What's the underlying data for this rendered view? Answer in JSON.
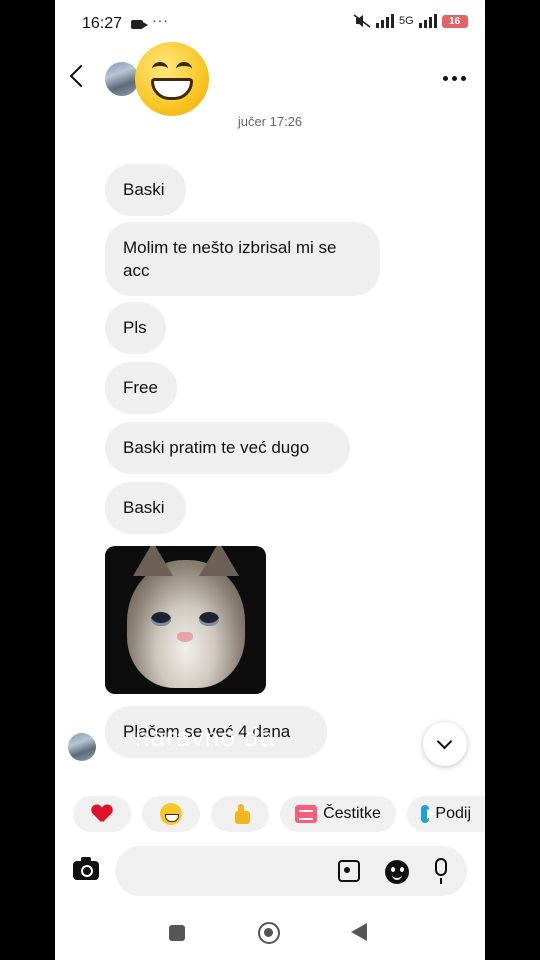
{
  "status_bar": {
    "time": "16:27",
    "dots": "···",
    "network": "5G",
    "battery": "16",
    "icons": [
      "camera-icon",
      "mute-icon",
      "signal-icon",
      "battery-icon"
    ]
  },
  "header": {
    "icons": [
      "back-arrow-icon",
      "grinning-emoji-icon",
      "more-icon"
    ]
  },
  "thread": {
    "timestamp": "jučer 17:26",
    "messages": [
      "Baski",
      "Molim te nešto izbrisal mi se acc",
      "Pls",
      "Free",
      "Baski pratim te već dugo",
      "Baski",
      "Plačem se već 4 dana"
    ],
    "image_description": "crying kitten meme",
    "overlay_caption": "naravno da"
  },
  "quick_replies": [
    {
      "icon": "heart-icon",
      "label": ""
    },
    {
      "icon": "laughing-emoji-icon",
      "label": ""
    },
    {
      "icon": "thumbs-up-icon",
      "label": ""
    },
    {
      "icon": "gift-icon",
      "label": "Čestitke"
    },
    {
      "icon": "play-icon",
      "label": "Podij"
    }
  ],
  "composer": {
    "placeholder": "",
    "icons": [
      "camera-icon",
      "gallery-icon",
      "sticker-icon",
      "microphone-icon"
    ]
  },
  "colors": {
    "bubble": "#efefef",
    "background": "#ffffff",
    "heart": "#e0112b",
    "battery": "#e26468"
  }
}
